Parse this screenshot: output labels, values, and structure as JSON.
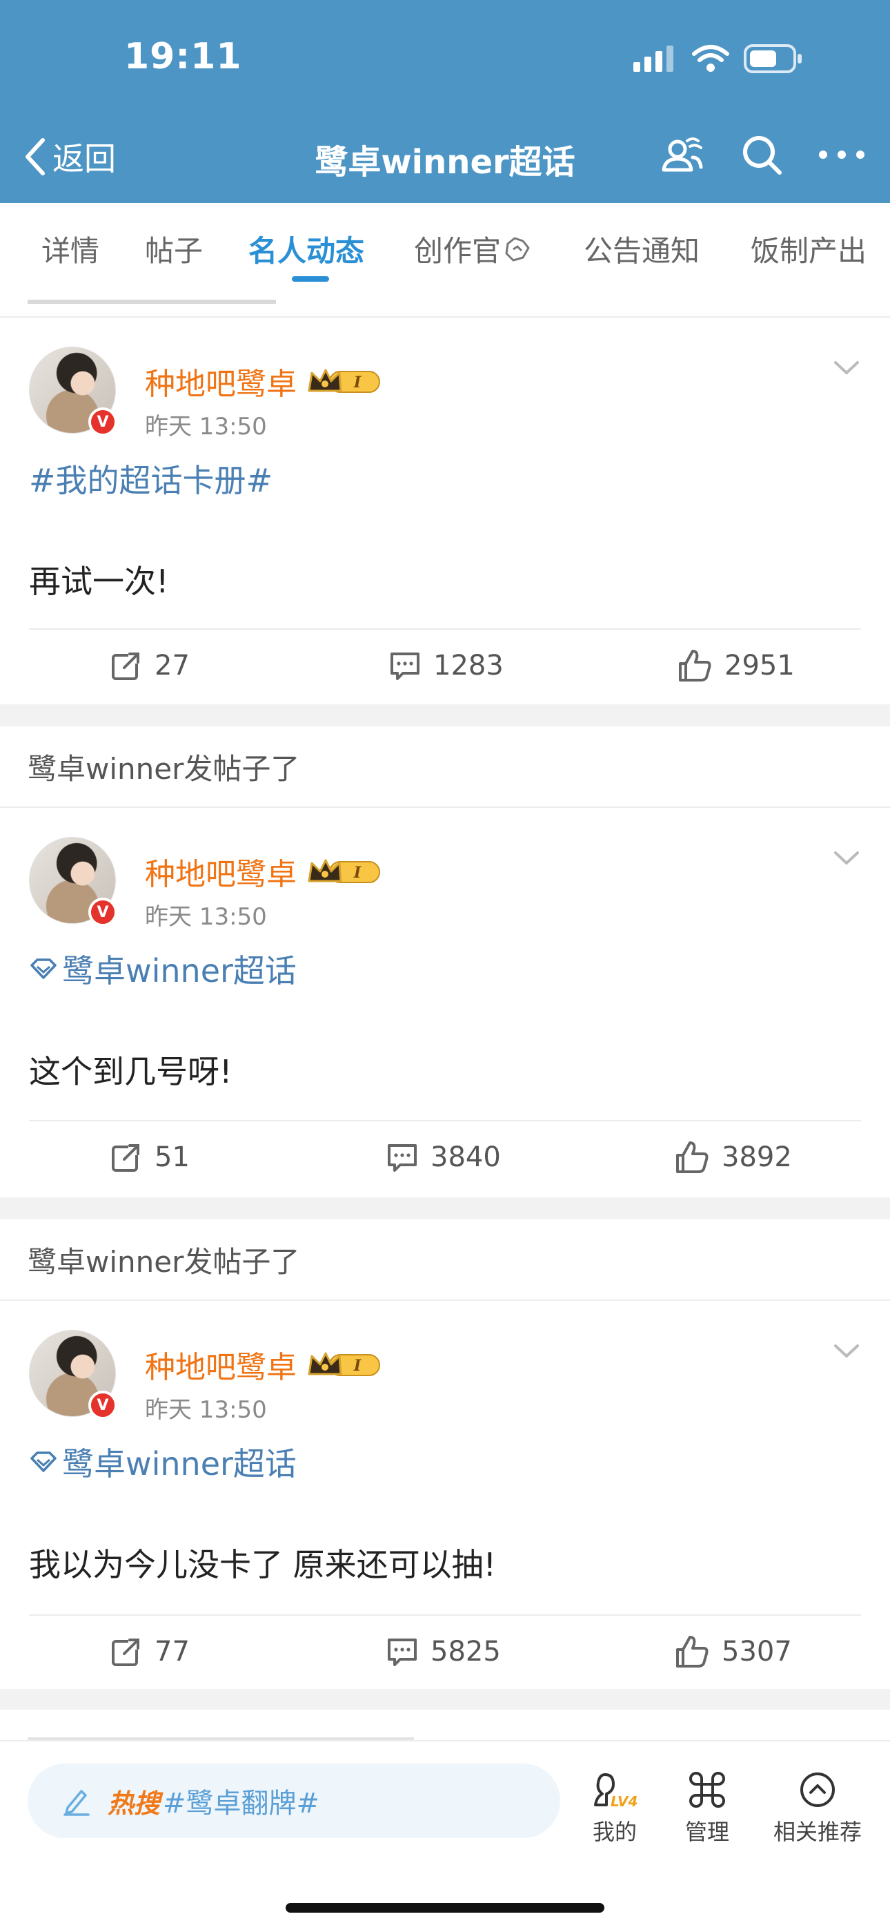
{
  "status_bar": {
    "time": "19:11"
  },
  "nav": {
    "back_label": "返回",
    "title": "鹭卓winner超话"
  },
  "tabs": [
    {
      "label": "详情"
    },
    {
      "label": "帖子"
    },
    {
      "label": "名人动态",
      "active": true
    },
    {
      "label": "创作官"
    },
    {
      "label": "公告通知"
    },
    {
      "label": "饭制产出"
    }
  ],
  "posts": [
    {
      "header": "",
      "author": "种地吧鹭卓",
      "level": "I",
      "time": "昨天 13:50",
      "topic": "#我的超话卡册#",
      "text": "再试一次!",
      "reposts": "27",
      "comments": "1283",
      "likes": "2951"
    },
    {
      "header": "鹭卓winner发帖子了",
      "author": "种地吧鹭卓",
      "level": "I",
      "time": "昨天 13:50",
      "topic": "鹭卓winner超话",
      "text": "这个到几号呀!",
      "reposts": "51",
      "comments": "3840",
      "likes": "3892"
    },
    {
      "header": "鹭卓winner发帖子了",
      "author": "种地吧鹭卓",
      "level": "I",
      "time": "昨天 13:50",
      "topic": "鹭卓winner超话",
      "text": "我以为今儿没卡了 原来还可以抽!",
      "reposts": "77",
      "comments": "5825",
      "likes": "5307"
    }
  ],
  "bottom_bar": {
    "hot_label": "热搜",
    "hot_tag": "#鹭卓翻牌#",
    "mine_label": "我的",
    "mine_level": "LV4",
    "manage_label": "管理",
    "related_label": "相关推荐"
  },
  "colors": {
    "header_bg": "#4d95c5",
    "accent_blue": "#2a8fd4",
    "author_orange": "#f07414",
    "link_blue": "#4a7fb3",
    "hot_orange": "#f07a1a"
  }
}
